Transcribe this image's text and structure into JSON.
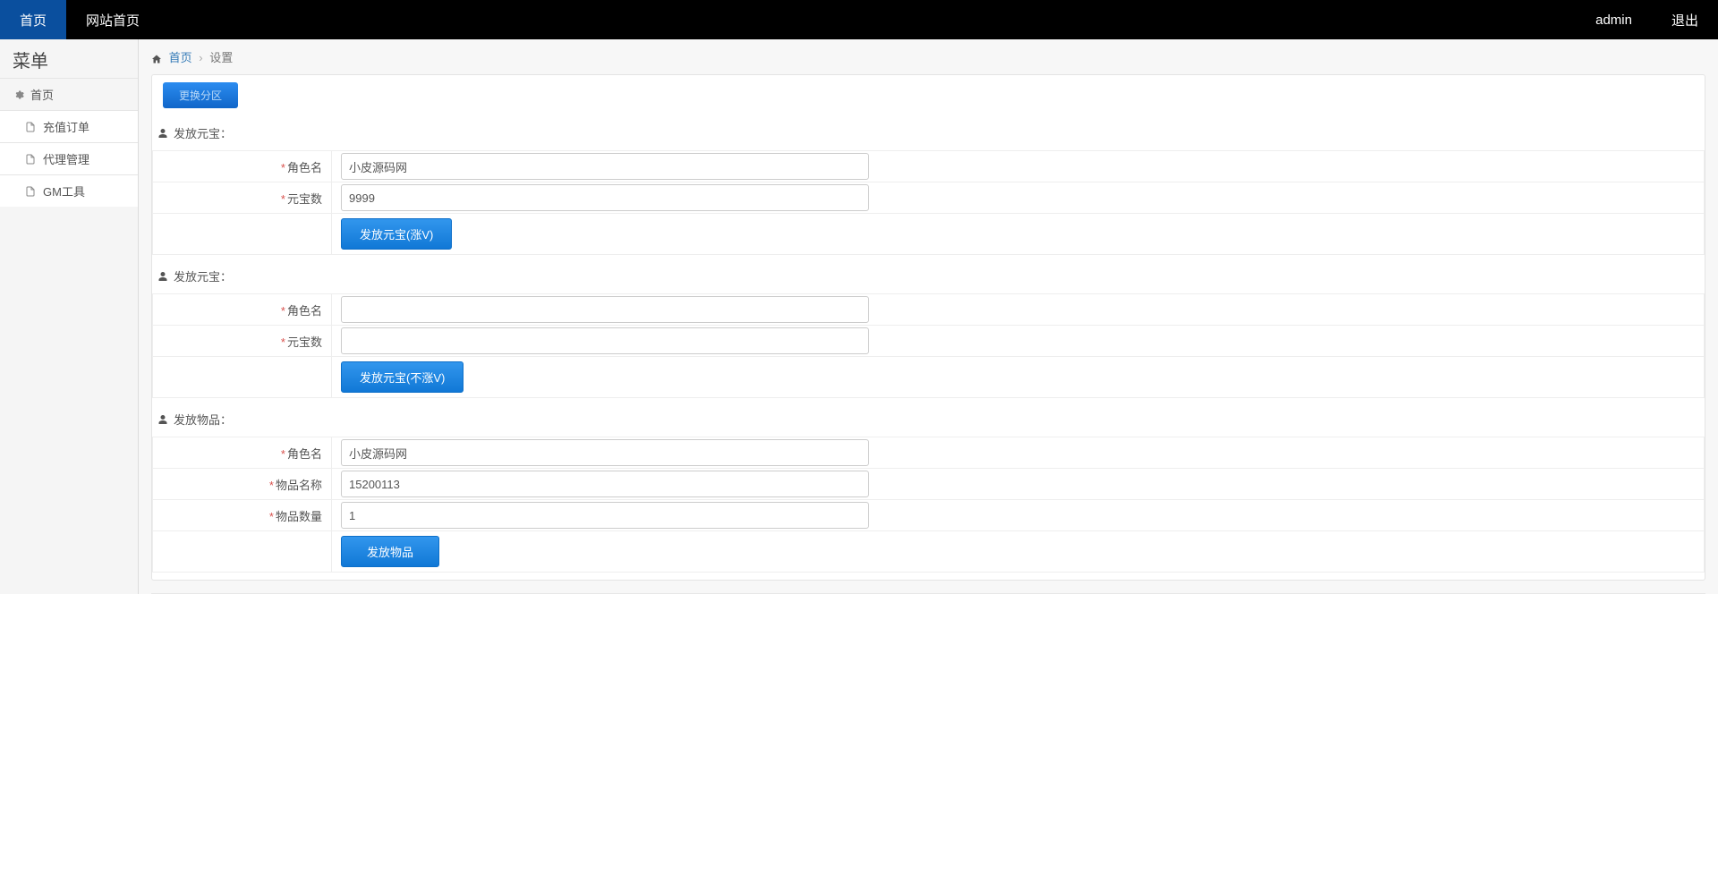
{
  "topbar": {
    "home": "首页",
    "site_home": "网站首页",
    "user": "admin",
    "logout": "退出"
  },
  "sidebar": {
    "title": "菜单",
    "root": "首页",
    "items": [
      {
        "label": "充值订单"
      },
      {
        "label": "代理管理"
      },
      {
        "label": "GM工具"
      }
    ]
  },
  "breadcrumb": {
    "home": "首页",
    "current": "设置"
  },
  "switch_zone_label": "更换分区",
  "section1": {
    "title": "发放元宝：",
    "role_label": "角色名",
    "role_value": "小皮源码网",
    "amount_label": "元宝数",
    "amount_value": "9999",
    "button": "发放元宝(涨V)"
  },
  "section2": {
    "title": "发放元宝：",
    "role_label": "角色名",
    "role_value": "",
    "amount_label": "元宝数",
    "amount_value": "",
    "button": "发放元宝(不涨V)"
  },
  "section3": {
    "title": "发放物品：",
    "role_label": "角色名",
    "role_value": "小皮源码网",
    "item_name_label": "物品名称",
    "item_name_value": "15200113",
    "item_qty_label": "物品数量",
    "item_qty_value": "1",
    "button": "发放物品"
  }
}
